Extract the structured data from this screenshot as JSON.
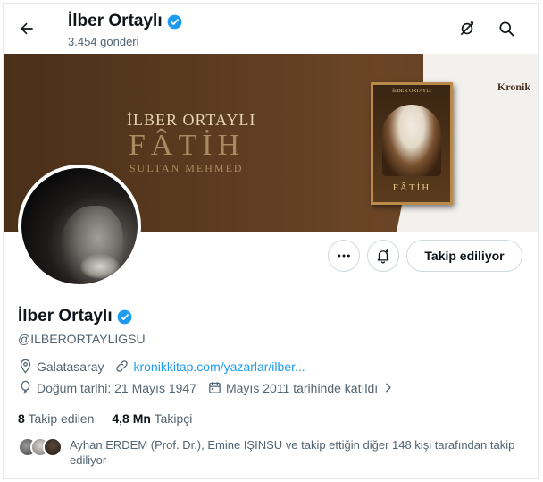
{
  "header": {
    "name": "İlber Ortaylı",
    "post_count": "3.454 gönderi"
  },
  "banner": {
    "author": "İLBER ORTAYLI",
    "title": "FÂTİH",
    "subtitle": "SULTAN MEHMED",
    "publisher": "Kronik",
    "book_top": "İLBER ORTAYLI",
    "book_title": "FÂTİH"
  },
  "actions": {
    "follow_label": "Takip ediliyor"
  },
  "profile": {
    "name": "İlber Ortaylı",
    "handle": "@ILBERORTAYLIGSU",
    "location": "Galatasaray",
    "link": "kronikkitap.com/yazarlar/ilber...",
    "birthday": "Doğum tarihi: 21 Mayıs 1947",
    "joined": "Mayıs 2011 tarihinde katıldı",
    "following_count": "8",
    "following_label": "Takip edilen",
    "followers_count": "4,8 Mn",
    "followers_label": "Takipçi",
    "followed_by": "Ayhan ERDEM (Prof. Dr.), Emine IŞINSU ve takip ettiğin diğer 148 kişi tarafından takip ediliyor"
  },
  "colors": {
    "accent": "#1d9bf0",
    "text": "#0f1419",
    "secondary": "#536471",
    "border": "#cfd9de"
  },
  "icons": [
    "back-arrow-icon",
    "verified-badge-icon",
    "retweet-off-icon",
    "search-icon",
    "more-icon",
    "notification-bell-icon",
    "location-icon",
    "link-icon",
    "birthday-balloon-icon",
    "calendar-icon",
    "chevron-right-icon"
  ]
}
